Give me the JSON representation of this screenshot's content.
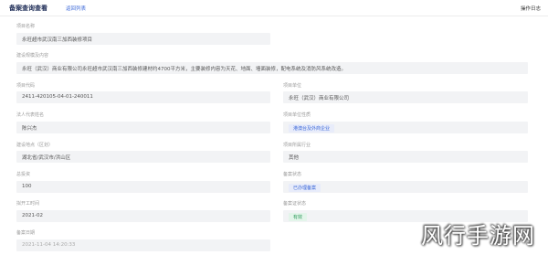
{
  "header": {
    "title": "备案查询查看",
    "link": "返回列表",
    "action": "操作日志"
  },
  "fields": {
    "project_name": {
      "label": "项目名称",
      "value": "永旺超市武汉南三加西装修项目"
    },
    "scale": {
      "label": "建设规模及内容",
      "value": "永旺（武汉）商业有限公司永旺超市武汉南三加西装修建材约4700平方米，主要装修内容为天花、地面、墙面装修，配电系统及消防风系统改造。"
    },
    "code": {
      "label": "项目代码",
      "value": "2411-420105-04-01-240011"
    },
    "unit": {
      "label": "项目单位",
      "value": "永旺（武汉）商业有限公司"
    },
    "legal_rep": {
      "label": "法人代表姓名",
      "value": "陈兴杰"
    },
    "nature": {
      "label": "项目单位性质",
      "value": "港澳台及外商企业"
    },
    "location": {
      "label": "建设地点（区划）",
      "value": "湖北省/武汉市/洪山区"
    },
    "industry": {
      "label": "项目所属行业",
      "value": "其他"
    },
    "investment": {
      "label": "总投资",
      "value": "100"
    },
    "status": {
      "label": "备案状态",
      "value": "已办理备案"
    },
    "start_time": {
      "label": "拟开工时间",
      "value": "2021-02"
    },
    "record_status": {
      "label": "备案证状态",
      "value": "有效"
    },
    "date": {
      "label": "备案日期",
      "value": "2021-11-04 14:20:33"
    }
  },
  "watermark": "风行手游网"
}
